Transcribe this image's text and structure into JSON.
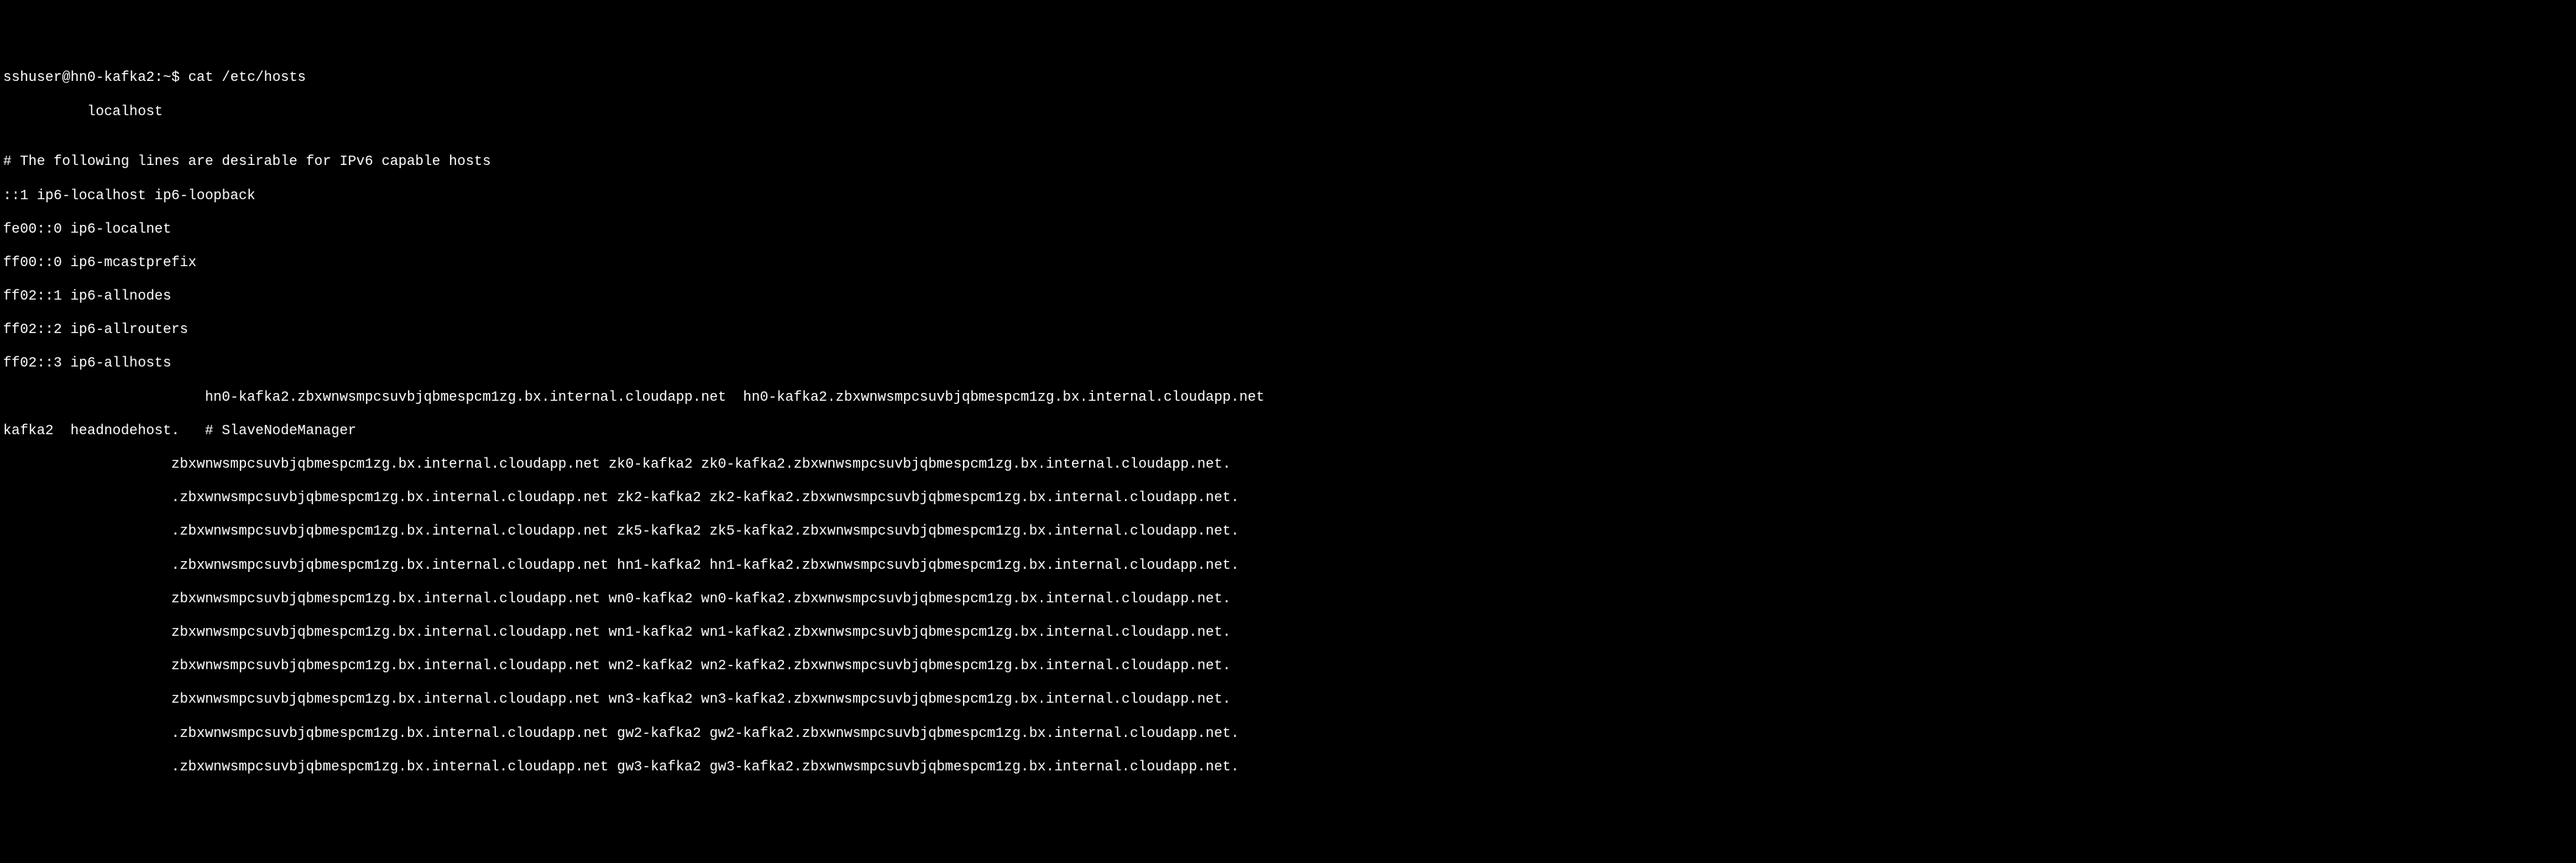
{
  "terminal": {
    "prompt": {
      "user": "sshuser",
      "host": "hn0-kafka2",
      "path": "~",
      "symbol": "$"
    },
    "command": "cat /etc/hosts",
    "output_lines": [
      "          localhost",
      "",
      "# The following lines are desirable for IPv6 capable hosts",
      "::1 ip6-localhost ip6-loopback",
      "fe00::0 ip6-localnet",
      "ff00::0 ip6-mcastprefix",
      "ff02::1 ip6-allnodes",
      "ff02::2 ip6-allrouters",
      "ff02::3 ip6-allhosts",
      "                        hn0-kafka2.zbxwnwsmpcsuvbjqbmespcm1zg.bx.internal.cloudapp.net  hn0-kafka2.zbxwnwsmpcsuvbjqbmespcm1zg.bx.internal.cloudapp.net",
      "kafka2  headnodehost.   # SlaveNodeManager",
      "                    zbxwnwsmpcsuvbjqbmespcm1zg.bx.internal.cloudapp.net zk0-kafka2 zk0-kafka2.zbxwnwsmpcsuvbjqbmespcm1zg.bx.internal.cloudapp.net.",
      "                    .zbxwnwsmpcsuvbjqbmespcm1zg.bx.internal.cloudapp.net zk2-kafka2 zk2-kafka2.zbxwnwsmpcsuvbjqbmespcm1zg.bx.internal.cloudapp.net.",
      "                    .zbxwnwsmpcsuvbjqbmespcm1zg.bx.internal.cloudapp.net zk5-kafka2 zk5-kafka2.zbxwnwsmpcsuvbjqbmespcm1zg.bx.internal.cloudapp.net.",
      "                    .zbxwnwsmpcsuvbjqbmespcm1zg.bx.internal.cloudapp.net hn1-kafka2 hn1-kafka2.zbxwnwsmpcsuvbjqbmespcm1zg.bx.internal.cloudapp.net.",
      "                    zbxwnwsmpcsuvbjqbmespcm1zg.bx.internal.cloudapp.net wn0-kafka2 wn0-kafka2.zbxwnwsmpcsuvbjqbmespcm1zg.bx.internal.cloudapp.net.",
      "                    zbxwnwsmpcsuvbjqbmespcm1zg.bx.internal.cloudapp.net wn1-kafka2 wn1-kafka2.zbxwnwsmpcsuvbjqbmespcm1zg.bx.internal.cloudapp.net.",
      "                    zbxwnwsmpcsuvbjqbmespcm1zg.bx.internal.cloudapp.net wn2-kafka2 wn2-kafka2.zbxwnwsmpcsuvbjqbmespcm1zg.bx.internal.cloudapp.net.",
      "                    zbxwnwsmpcsuvbjqbmespcm1zg.bx.internal.cloudapp.net wn3-kafka2 wn3-kafka2.zbxwnwsmpcsuvbjqbmespcm1zg.bx.internal.cloudapp.net.",
      "                    .zbxwnwsmpcsuvbjqbmespcm1zg.bx.internal.cloudapp.net gw2-kafka2 gw2-kafka2.zbxwnwsmpcsuvbjqbmespcm1zg.bx.internal.cloudapp.net.",
      "                    .zbxwnwsmpcsuvbjqbmespcm1zg.bx.internal.cloudapp.net gw3-kafka2 gw3-kafka2.zbxwnwsmpcsuvbjqbmespcm1zg.bx.internal.cloudapp.net."
    ]
  }
}
